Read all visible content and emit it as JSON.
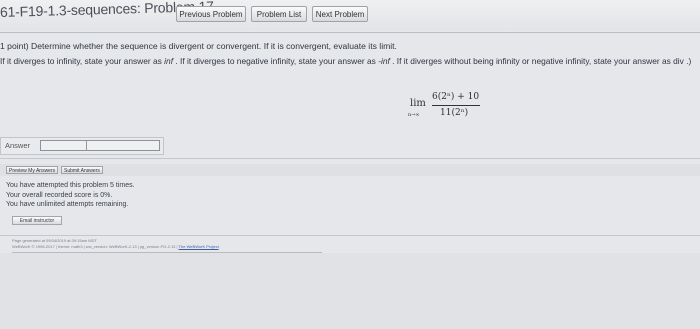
{
  "header": {
    "title": "61-F19-1.3-sequences: Problem 17",
    "nav": [
      "Previous Problem",
      "Problem List",
      "Next Problem"
    ]
  },
  "problem": {
    "points": "1 point) Determine whether the sequence is divergent or convergent. If it is convergent, evaluate its limit.",
    "instructions_pre": "If it diverges to infinity, state your answer as ",
    "inf": "inf",
    "instructions_mid": " . If it diverges to negative infinity, state your answer as ",
    "neginf": "-inf",
    "instructions_post": " . If it diverges without being infinity or negative infinity, state your answer as div .)",
    "math": {
      "lim": "lim",
      "under": "n→∞",
      "numerator": "6(2ⁿ) + 10",
      "denominator": "11(2ⁿ)"
    }
  },
  "answer": {
    "label": "Answer",
    "value": ""
  },
  "actions": {
    "preview": "Preview My Answers",
    "submit": "Submit Answers"
  },
  "status": {
    "line1": "You have attempted this problem 5 times.",
    "line2": "Your overall recorded score is 0%.",
    "line3": "You have unlimited attempts remaining."
  },
  "email_label": "Email instructor",
  "footer": {
    "generated": "Page generated at 09/04/2019 at 09:15am MDT",
    "versions": "WeBWorK © 1996-2017 | theme: math3 | ww_version: WeBWorK-2.13 | pg_version PG-2.13 | ",
    "project_link": "The WeBWorK Project"
  }
}
